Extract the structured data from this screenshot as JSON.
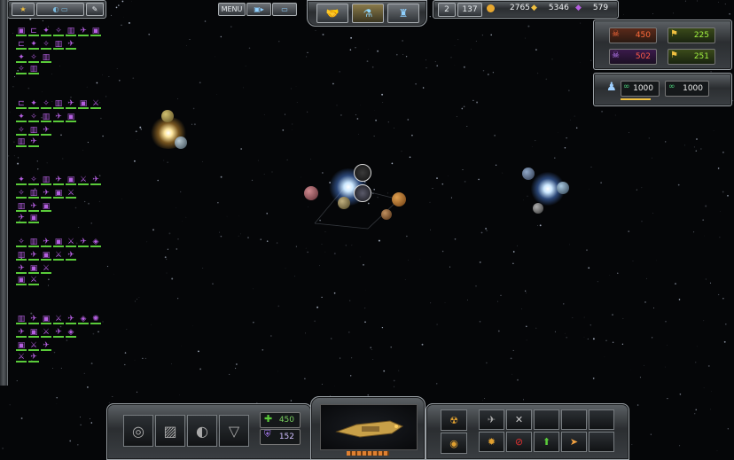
{
  "topbar": {
    "menu_label": "MENU",
    "fleet_count": "2",
    "fleet_supply": "137",
    "credits": "2765",
    "metal": "5346",
    "crystal": "579"
  },
  "diplomacy": {
    "left_top": "450",
    "right_top": "225",
    "left_bottom": "502",
    "right_bottom": "251",
    "bounty_left": "1000",
    "bounty_right": "1000"
  },
  "bottom": {
    "strike_value": "450",
    "shield_value": "152"
  },
  "colors": {
    "accent": "#b45fe0",
    "green": "#5acb3a",
    "red": "#e04a3a",
    "gold": "#f0c040"
  }
}
